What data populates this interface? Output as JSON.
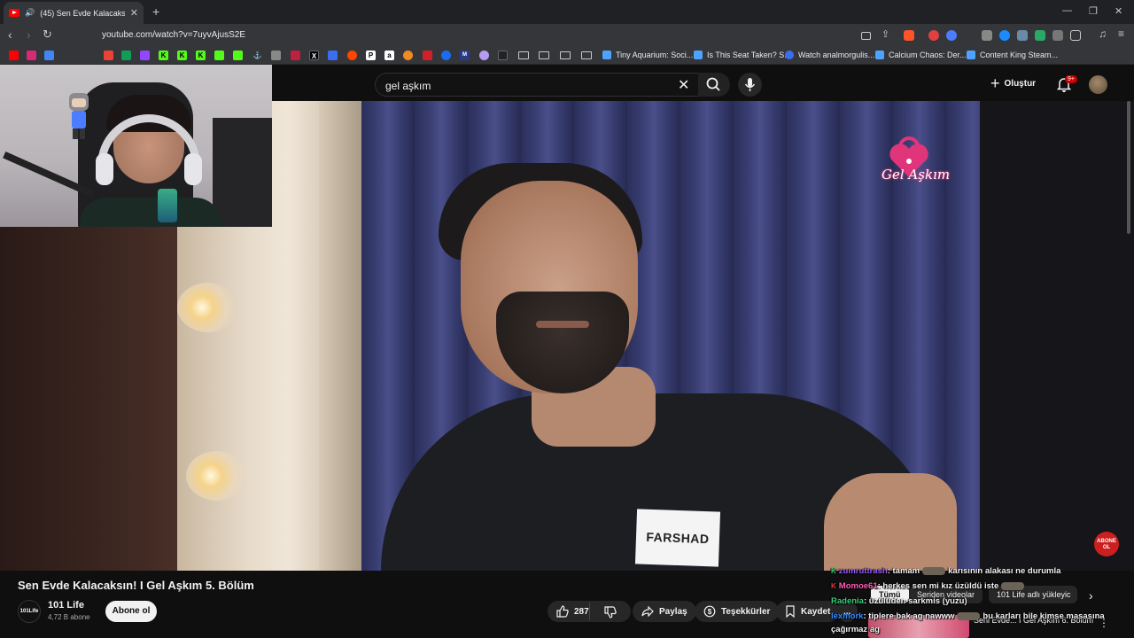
{
  "browser": {
    "tab_title": "(45) Sen Evde Kalacaksın! I Ge",
    "url": "youtube.com/watch?v=7uyvAjusS2E",
    "bookmarks": [
      {
        "label": "Tiny Aquarium: Soci...",
        "color": "#4da3ff"
      },
      {
        "label": "Is This Seat Taken? S...",
        "color": "#4da3ff"
      },
      {
        "label": "Watch analmorgulis...",
        "color": "#3a6df0"
      },
      {
        "label": "Calcium Chaos: Der...",
        "color": "#4da3ff"
      },
      {
        "label": "Content King Steam...",
        "color": "#4da3ff"
      }
    ]
  },
  "youtube": {
    "search_value": "gel aşkım",
    "create_label": "Oluştur",
    "notification_count": "9+"
  },
  "video": {
    "name_tag": "FARSHAD",
    "logo_text": "Gel Aşkım",
    "corner_badge": "ABONE OL",
    "title": "Sen Evde Kalacaksın! I Gel Aşkım 5. Bölüm",
    "channel_avatar_text": "101Life",
    "channel_name": "101 Life",
    "subscribers": "4,72 B abone",
    "subscribe_label": "Abone ol",
    "like_count": "287",
    "share_label": "Paylaş",
    "thanks_label": "Teşekkürler",
    "save_label": "Kaydet",
    "more_label": "..."
  },
  "chips": [
    "Tümü",
    "Seriden videolar",
    "101 Life adlı yükleyic"
  ],
  "up_next_title": "Seni Evde... I Gel Aşkım 6. Bölüm",
  "chat": [
    {
      "badge": "K",
      "badge_color": "#36d17a",
      "user": "zumruttrash",
      "user_color": "#9b5cff",
      "message": ": tamam",
      "emote": true,
      "message2": "karısının alakası ne durumla"
    },
    {
      "badge": "K",
      "badge_color": "#e04040",
      "user": "Momoe61",
      "user_color": "#ff5ab4",
      "message": ": herkes sen mi kız üzüldü iste",
      "emote": true,
      "message2": ""
    },
    {
      "badge": "",
      "badge_color": "",
      "user": "Radenia",
      "user_color": "#36d17a",
      "message": ": üzülüden sarkmis (yuzu)",
      "emote": false,
      "message2": ""
    },
    {
      "badge": "",
      "badge_color": "",
      "user": "lexmork",
      "user_color": "#3a8cff",
      "message": ": tiplere bak ag nawww",
      "emote": true,
      "message2": "bu karları bile kimse masasına"
    },
    {
      "badge": "",
      "badge_color": "",
      "user": "",
      "user_color": "#f1f1f1",
      "message": "çağırmaz ag",
      "emote": false,
      "message2": ""
    }
  ]
}
